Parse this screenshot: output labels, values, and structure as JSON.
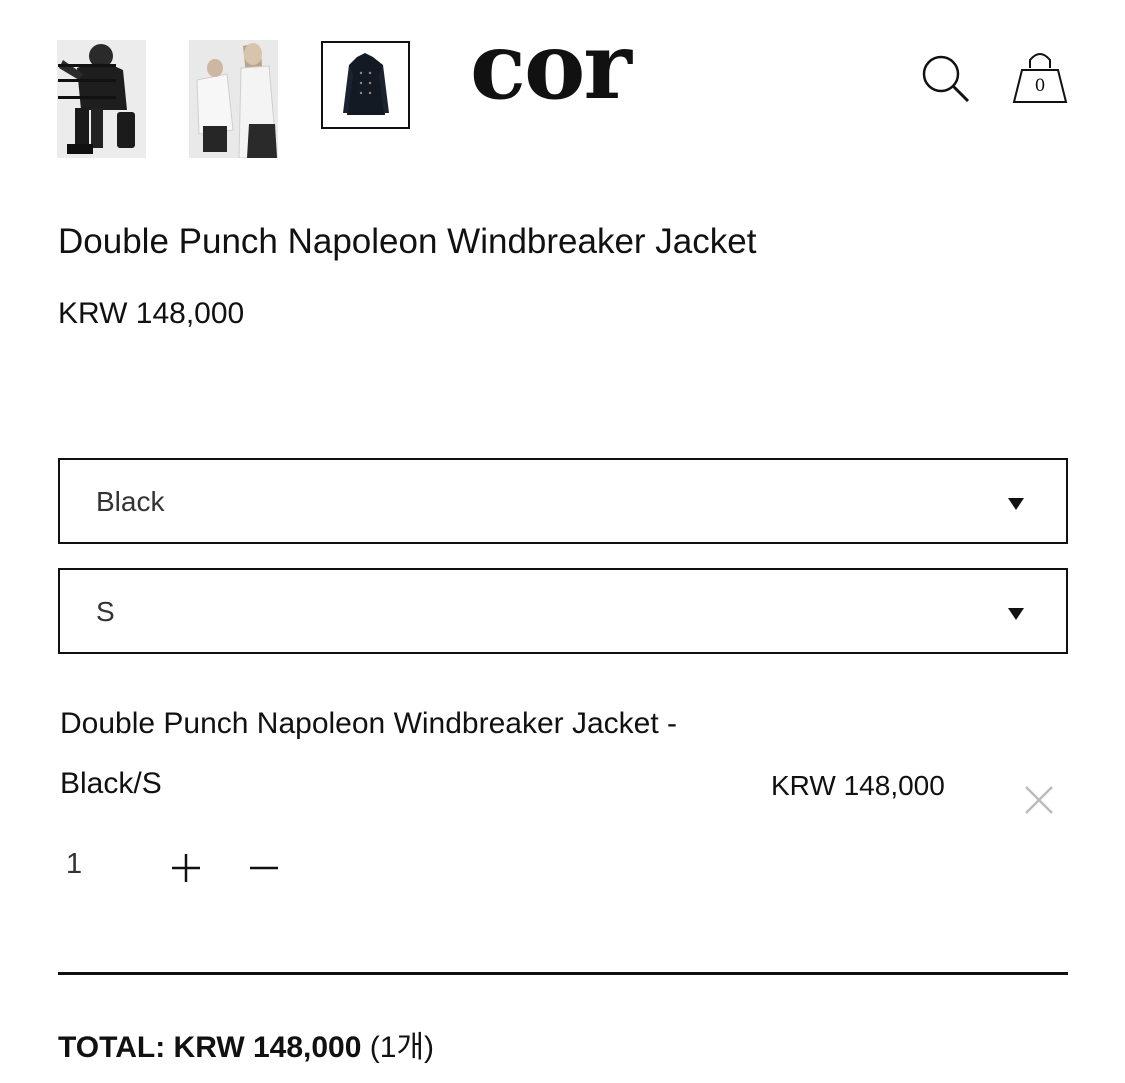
{
  "header": {
    "brand": "cor",
    "cart_count": "0"
  },
  "gallery": {
    "thumbnails": [
      "model-look-1",
      "model-look-2",
      "jacket-flat"
    ],
    "selected_index": 2
  },
  "product": {
    "title": "Double Punch Napoleon Windbreaker Jacket",
    "price": "KRW 148,000"
  },
  "options": {
    "color": "Black",
    "size": "S"
  },
  "line_item": {
    "name": "Double Punch Napoleon Windbreaker Jacket - Black/S",
    "price": "KRW 148,000",
    "quantity": "1"
  },
  "total": {
    "label": "TOTAL: KRW 148,000",
    "count": "(1개)"
  },
  "icons": [
    "menu-icon",
    "search-icon",
    "shopping-bag-icon",
    "close-icon",
    "plus-icon",
    "minus-icon",
    "caret-down-icon"
  ],
  "colors": {
    "text": "#111111",
    "muted": "#bbbbbb",
    "background": "#ffffff"
  }
}
